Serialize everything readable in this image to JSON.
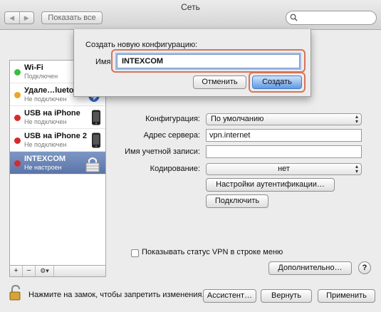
{
  "window": {
    "title": "Сеть",
    "show_all": "Показать все",
    "nav_back": "◀",
    "nav_forward": "▶"
  },
  "services": [
    {
      "name": "Wi-Fi",
      "status": "Подключен",
      "color": "#3cbf3c",
      "icon": "wifi-icon"
    },
    {
      "name": "Удале…luetooth",
      "status": "Не подключен",
      "color": "#e9a828",
      "icon": "bluetooth-icon"
    },
    {
      "name": "USB на iPhone",
      "status": "Не подключен",
      "color": "#d62b2b",
      "icon": "iphone-icon"
    },
    {
      "name": "USB на iPhone 2",
      "status": "Не подключен",
      "color": "#d62b2b",
      "icon": "iphone-icon"
    },
    {
      "name": "INTEXCOM",
      "status": "Не настроен",
      "color": "#d62b2b",
      "icon": "vpn-lock-icon"
    }
  ],
  "sidebar_tools": {
    "add": "+",
    "remove": "−",
    "action": "⚙▾"
  },
  "settings": {
    "config_label": "Конфигурация:",
    "config_value": "По умолчанию",
    "server_label": "Адрес сервера:",
    "server_value": "vpn.internet",
    "account_label": "Имя учетной записи:",
    "account_value": "",
    "encryption_label": "Кодирование:",
    "encryption_value": "нет",
    "auth_button": "Настройки аутентификации…",
    "connect_button": "Подключить",
    "show_vpn_status": "Показывать статус VPN в строке меню",
    "show_vpn_status_checked": false,
    "advanced_button": "Дополнительно…",
    "help": "?"
  },
  "bottom": {
    "lock_text": "Нажмите на замок, чтобы запретить изменения.",
    "assistant": "Ассистент…",
    "revert": "Вернуть",
    "apply": "Применить"
  },
  "sheet": {
    "title": "Создать новую конфигурацию:",
    "name_label": "Имя",
    "name_value": "INTEXCOM",
    "cancel": "Отменить",
    "create": "Создать"
  }
}
